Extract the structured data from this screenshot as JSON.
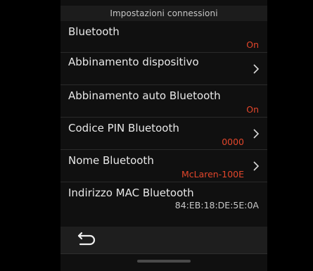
{
  "header": {
    "title": "Impostazioni connessioni"
  },
  "rows": [
    {
      "title": "Bluetooth",
      "value": "On",
      "has_chevron": false
    },
    {
      "title": "Abbinamento dispositivo",
      "value": "",
      "has_chevron": true
    },
    {
      "title": "Abbinamento auto Bluetooth",
      "value": "On",
      "has_chevron": false
    },
    {
      "title": "Codice PIN Bluetooth",
      "value": "0000",
      "has_chevron": true
    },
    {
      "title": "Nome Bluetooth",
      "value": "McLaren-100E",
      "has_chevron": true
    },
    {
      "title": "Indirizzo MAC Bluetooth",
      "value": "84:EB:18:DE:5E:0A",
      "has_chevron": false
    }
  ],
  "icons": {
    "chevron": "chevron-right-icon",
    "back": "back-arrow-icon"
  },
  "colors": {
    "accent": "#e2462b",
    "background": "#101010",
    "text": "#e8e8e8"
  }
}
